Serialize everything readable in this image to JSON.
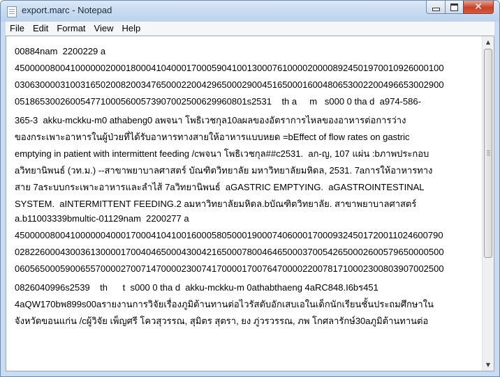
{
  "window": {
    "title": "export.marc - Notepad"
  },
  "menu": [
    "File",
    "Edit",
    "Format",
    "View",
    "Help"
  ],
  "caption": {
    "close_glyph": "✕"
  },
  "scrollbar": {
    "up_glyph": "▲",
    "down_glyph": "▼"
  },
  "content": {
    "lines": [
      "00884nam  2200229 a",
      "4500000800410000002000180004104000170005904100130007610000200008924501970010926000100",
      "0306300003100316502008200347650002200429650002900451650001600480653002200496653002900",
      "0518653002600547710005600573907002500629960801s2531    th a     m   s000 0 tha d  a974-586-",
      "365-3  akku-mckku-m0 athabeng0 aพจนา โพธิเวชกุล10aผลของอัตราการไหลของอาหารต่อการว่าง",
      "ของกระเพาะอาหารในผู้ป่วยที่ได้รับอาหารทางสายให้อาหารแบบหยด =bEffect of flow rates on gastric",
      "emptying in patient with intermittent feeding /cพจนา โพธิเวชกุล##c2531.  aก-ญ, 107 แผ่น :bภาพประกอบ",
      "aวิทยานิพนธ์ (วท.ม.) --สาขาพยาบาลศาสตร์ บัณฑิตวิทยาลัย มหาวิทยาลัยมหิดล, 2531. 7aการให้อาหารทาง",
      "สาย 7aระบบกระเพาะอาหารและลำไส้ 7aวิทยานิพนธ์  aGASTRIC EMPTYING.  aGASTROINTESTINAL",
      "SYSTEM.  aINTERMITTENT FEEDING.2 aมหาวิทยาลัยมหิดล.bบัณฑิตวิทยาลัย. สาขาพยาบาลศาสตร์",
      "a.b11003339bmultic-01129nam  2200277 a",
      "4500000800410000004000170004104100160005805000190007406000170009324501720011024600790",
      "0282260004300361300001700404650004300421650007800464650003700542650002600579650000500",
      "0605650005900655700002700714700002300741700001700764700002200781710002300803907002500",
      "0826040996s2539    th      t  s000 0 tha d  akku-mckku-m 0athabthaeng 4aRC848.I6bร451",
      "4aQW170bพ899s00aรายงานการวิจัยเรื่องภูมิต้านทานต่อไวรัสตับอักเสบเอในเด็กนักเรียนชั้นประถมศึกษาใน",
      "จังหวัดขอนแก่น /cผู้วิจัย เพ็ญศรี โควสุวรรณ, สุมิตร สุตรา, ยง ภู่วรวรรณ, ภพ โกศลารักษ์30aภูมิต้านทานต่อ"
    ]
  }
}
